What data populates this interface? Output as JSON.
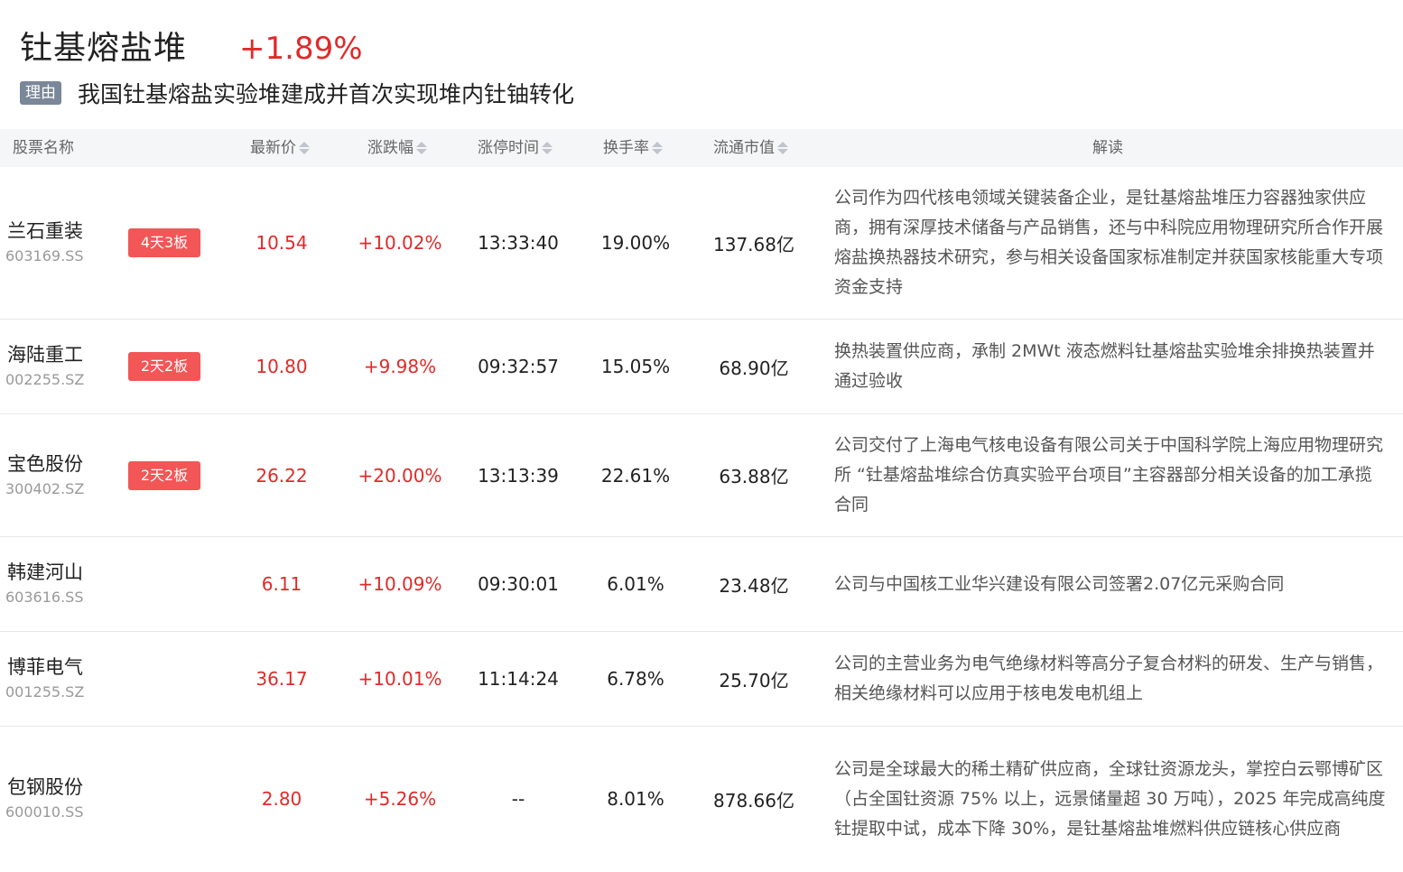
{
  "theme": {
    "title": "钍基熔盐堆",
    "change": "+1.89%"
  },
  "reason": {
    "tag": "理由",
    "text": "我国钍基熔盐实验堆建成并首次实现堆内钍铀转化"
  },
  "table": {
    "headers": {
      "name": "股票名称",
      "price": "最新价",
      "change": "涨跌幅",
      "limit_time": "涨停时间",
      "turnover": "换手率",
      "market_cap": "流通市值",
      "analysis": "解读"
    },
    "rows": [
      {
        "name": "兰石重装",
        "code": "603169.SS",
        "badge": "4天3板",
        "price": "10.54",
        "change": "+10.02%",
        "time": "13:33:40",
        "turnover": "19.00%",
        "cap": "137.68亿",
        "desc": "公司作为四代核电领域关键装备企业，是钍基熔盐堆压力容器独家供应商，拥有深厚技术储备与产品销售，还与中科院应用物理研究所合作开展熔盐换热器技术研究，参与相关设备国家标准制定并获国家核能重大专项资金支持"
      },
      {
        "name": "海陆重工",
        "code": "002255.SZ",
        "badge": "2天2板",
        "price": "10.80",
        "change": "+9.98%",
        "time": "09:32:57",
        "turnover": "15.05%",
        "cap": "68.90亿",
        "desc": "换热装置供应商，承制 2MWt 液态燃料钍基熔盐实验堆余排换热装置并通过验收"
      },
      {
        "name": "宝色股份",
        "code": "300402.SZ",
        "badge": "2天2板",
        "price": "26.22",
        "change": "+20.00%",
        "time": "13:13:39",
        "turnover": "22.61%",
        "cap": "63.88亿",
        "desc": "公司交付了上海电气核电设备有限公司关于中国科学院上海应用物理研究所 “钍基熔盐堆综合仿真实验平台项目”主容器部分相关设备的加工承揽合同"
      },
      {
        "name": "韩建河山",
        "code": "603616.SS",
        "badge": "",
        "price": "6.11",
        "change": "+10.09%",
        "time": "09:30:01",
        "turnover": "6.01%",
        "cap": "23.48亿",
        "desc": "公司与中国核工业华兴建设有限公司签署2.07亿元采购合同"
      },
      {
        "name": "博菲电气",
        "code": "001255.SZ",
        "badge": "",
        "price": "36.17",
        "change": "+10.01%",
        "time": "11:14:24",
        "turnover": "6.78%",
        "cap": "25.70亿",
        "desc": "公司的主营业务为电气绝缘材料等高分子复合材料的研发、生产与销售，相关绝缘材料可以应用于核电发电机组上"
      },
      {
        "name": "包钢股份",
        "code": "600010.SS",
        "badge": "",
        "price": "2.80",
        "change": "+5.26%",
        "time": "--",
        "turnover": "8.01%",
        "cap": "878.66亿",
        "desc": "公司是全球最大的稀土精矿供应商，全球钍资源龙头，掌控白云鄂博矿区（占全国钍资源 75% 以上，远景储量超 30 万吨），2025 年完成高纯度钍提取中试，成本下降 30%，是钍基熔盐堆燃料供应链核心供应商"
      }
    ]
  }
}
